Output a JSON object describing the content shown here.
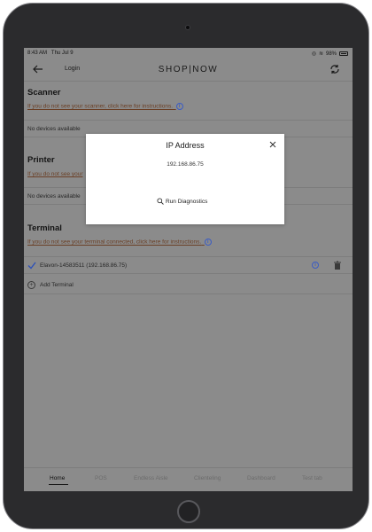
{
  "status_bar": {
    "time": "8:43 AM",
    "date": "Thu Jul 9",
    "battery": "98%"
  },
  "app_bar": {
    "back_icon": "arrow-left-icon",
    "login_label": "Login",
    "brand": "SHOP|NOW",
    "refresh_icon": "refresh-icon"
  },
  "scanner": {
    "title": "Scanner",
    "help_link": "If you do not see your scanner, click here for instructions.",
    "empty_text": "No devices available"
  },
  "printer": {
    "title": "Printer",
    "help_link": "If you do not see your",
    "empty_text": "No devices available"
  },
  "terminal": {
    "title": "Terminal",
    "help_link": "If you do not see your terminal connected, click here for instructions.",
    "device_label": "Elavon-14583511 (192.168.86.75)",
    "add_label": "Add Terminal"
  },
  "tabs": [
    {
      "label": "Home",
      "active": true
    },
    {
      "label": "POS"
    },
    {
      "label": "Endless Aisle"
    },
    {
      "label": "Clienteling"
    },
    {
      "label": "Dashboard"
    },
    {
      "label": "Test tab"
    }
  ],
  "modal": {
    "title": "IP Address",
    "ip": "192.168.86.75",
    "diagnostics_label": "Run Diagnostics"
  },
  "colors": {
    "overlay_screen": "#8b8b8b",
    "link": "#6a3f25",
    "accent_blue": "#3b5cc4",
    "device_frame": "#2b2b2d"
  }
}
